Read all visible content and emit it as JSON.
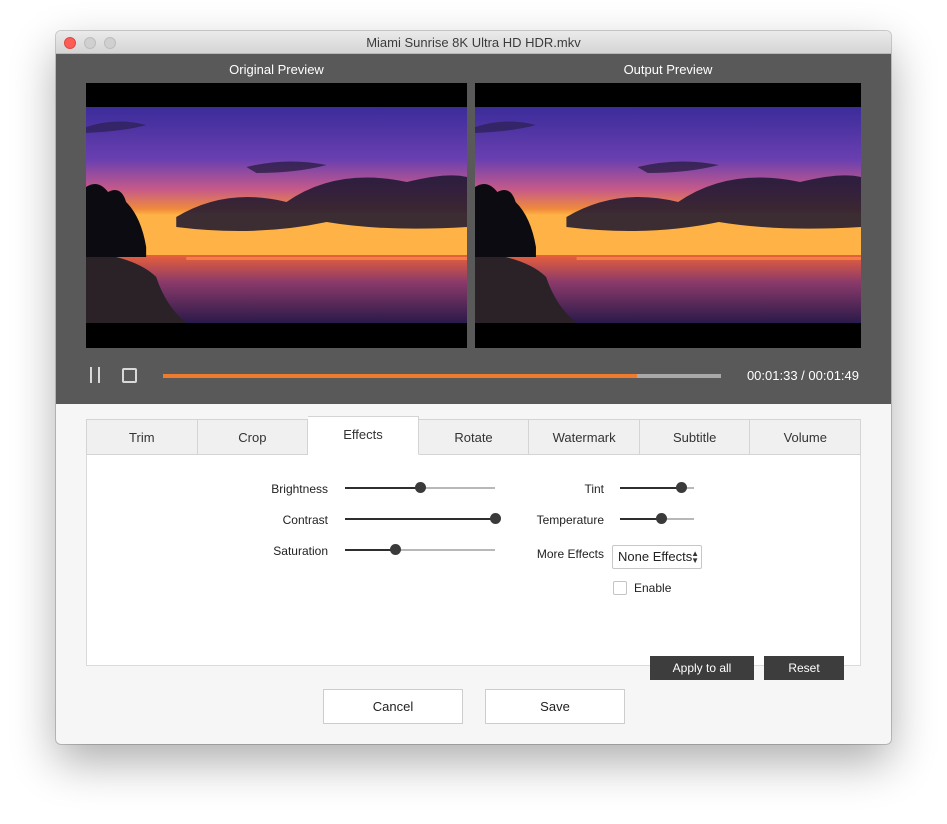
{
  "window": {
    "title": "Miami Sunrise 8K Ultra HD HDR.mkv"
  },
  "preview": {
    "original_label": "Original Preview",
    "output_label": "Output  Preview"
  },
  "player": {
    "timecode": "00:01:33 / 00:01:49",
    "progress_fraction": 0.85,
    "accent_color": "#ef7b2f"
  },
  "tabs": [
    {
      "label": "Trim"
    },
    {
      "label": "Crop"
    },
    {
      "label": "Effects"
    },
    {
      "label": "Rotate"
    },
    {
      "label": "Watermark"
    },
    {
      "label": "Subtitle"
    },
    {
      "label": "Volume"
    }
  ],
  "active_tab": "Effects",
  "effects": {
    "brightness": {
      "label": "Brightness",
      "value_fraction": 0.5
    },
    "contrast": {
      "label": "Contrast",
      "value_fraction": 1.0
    },
    "saturation": {
      "label": "Saturation",
      "value_fraction": 0.33
    },
    "tint": {
      "label": "Tint",
      "value_fraction": 0.82
    },
    "temperature": {
      "label": "Temperature",
      "value_fraction": 0.55
    },
    "more_effects": {
      "label": "More Effects",
      "selected": "None Effects"
    },
    "enable": {
      "label": "Enable",
      "checked": false
    },
    "apply_all_label": "Apply to all",
    "reset_label": "Reset"
  },
  "footer": {
    "cancel_label": "Cancel",
    "save_label": "Save"
  }
}
